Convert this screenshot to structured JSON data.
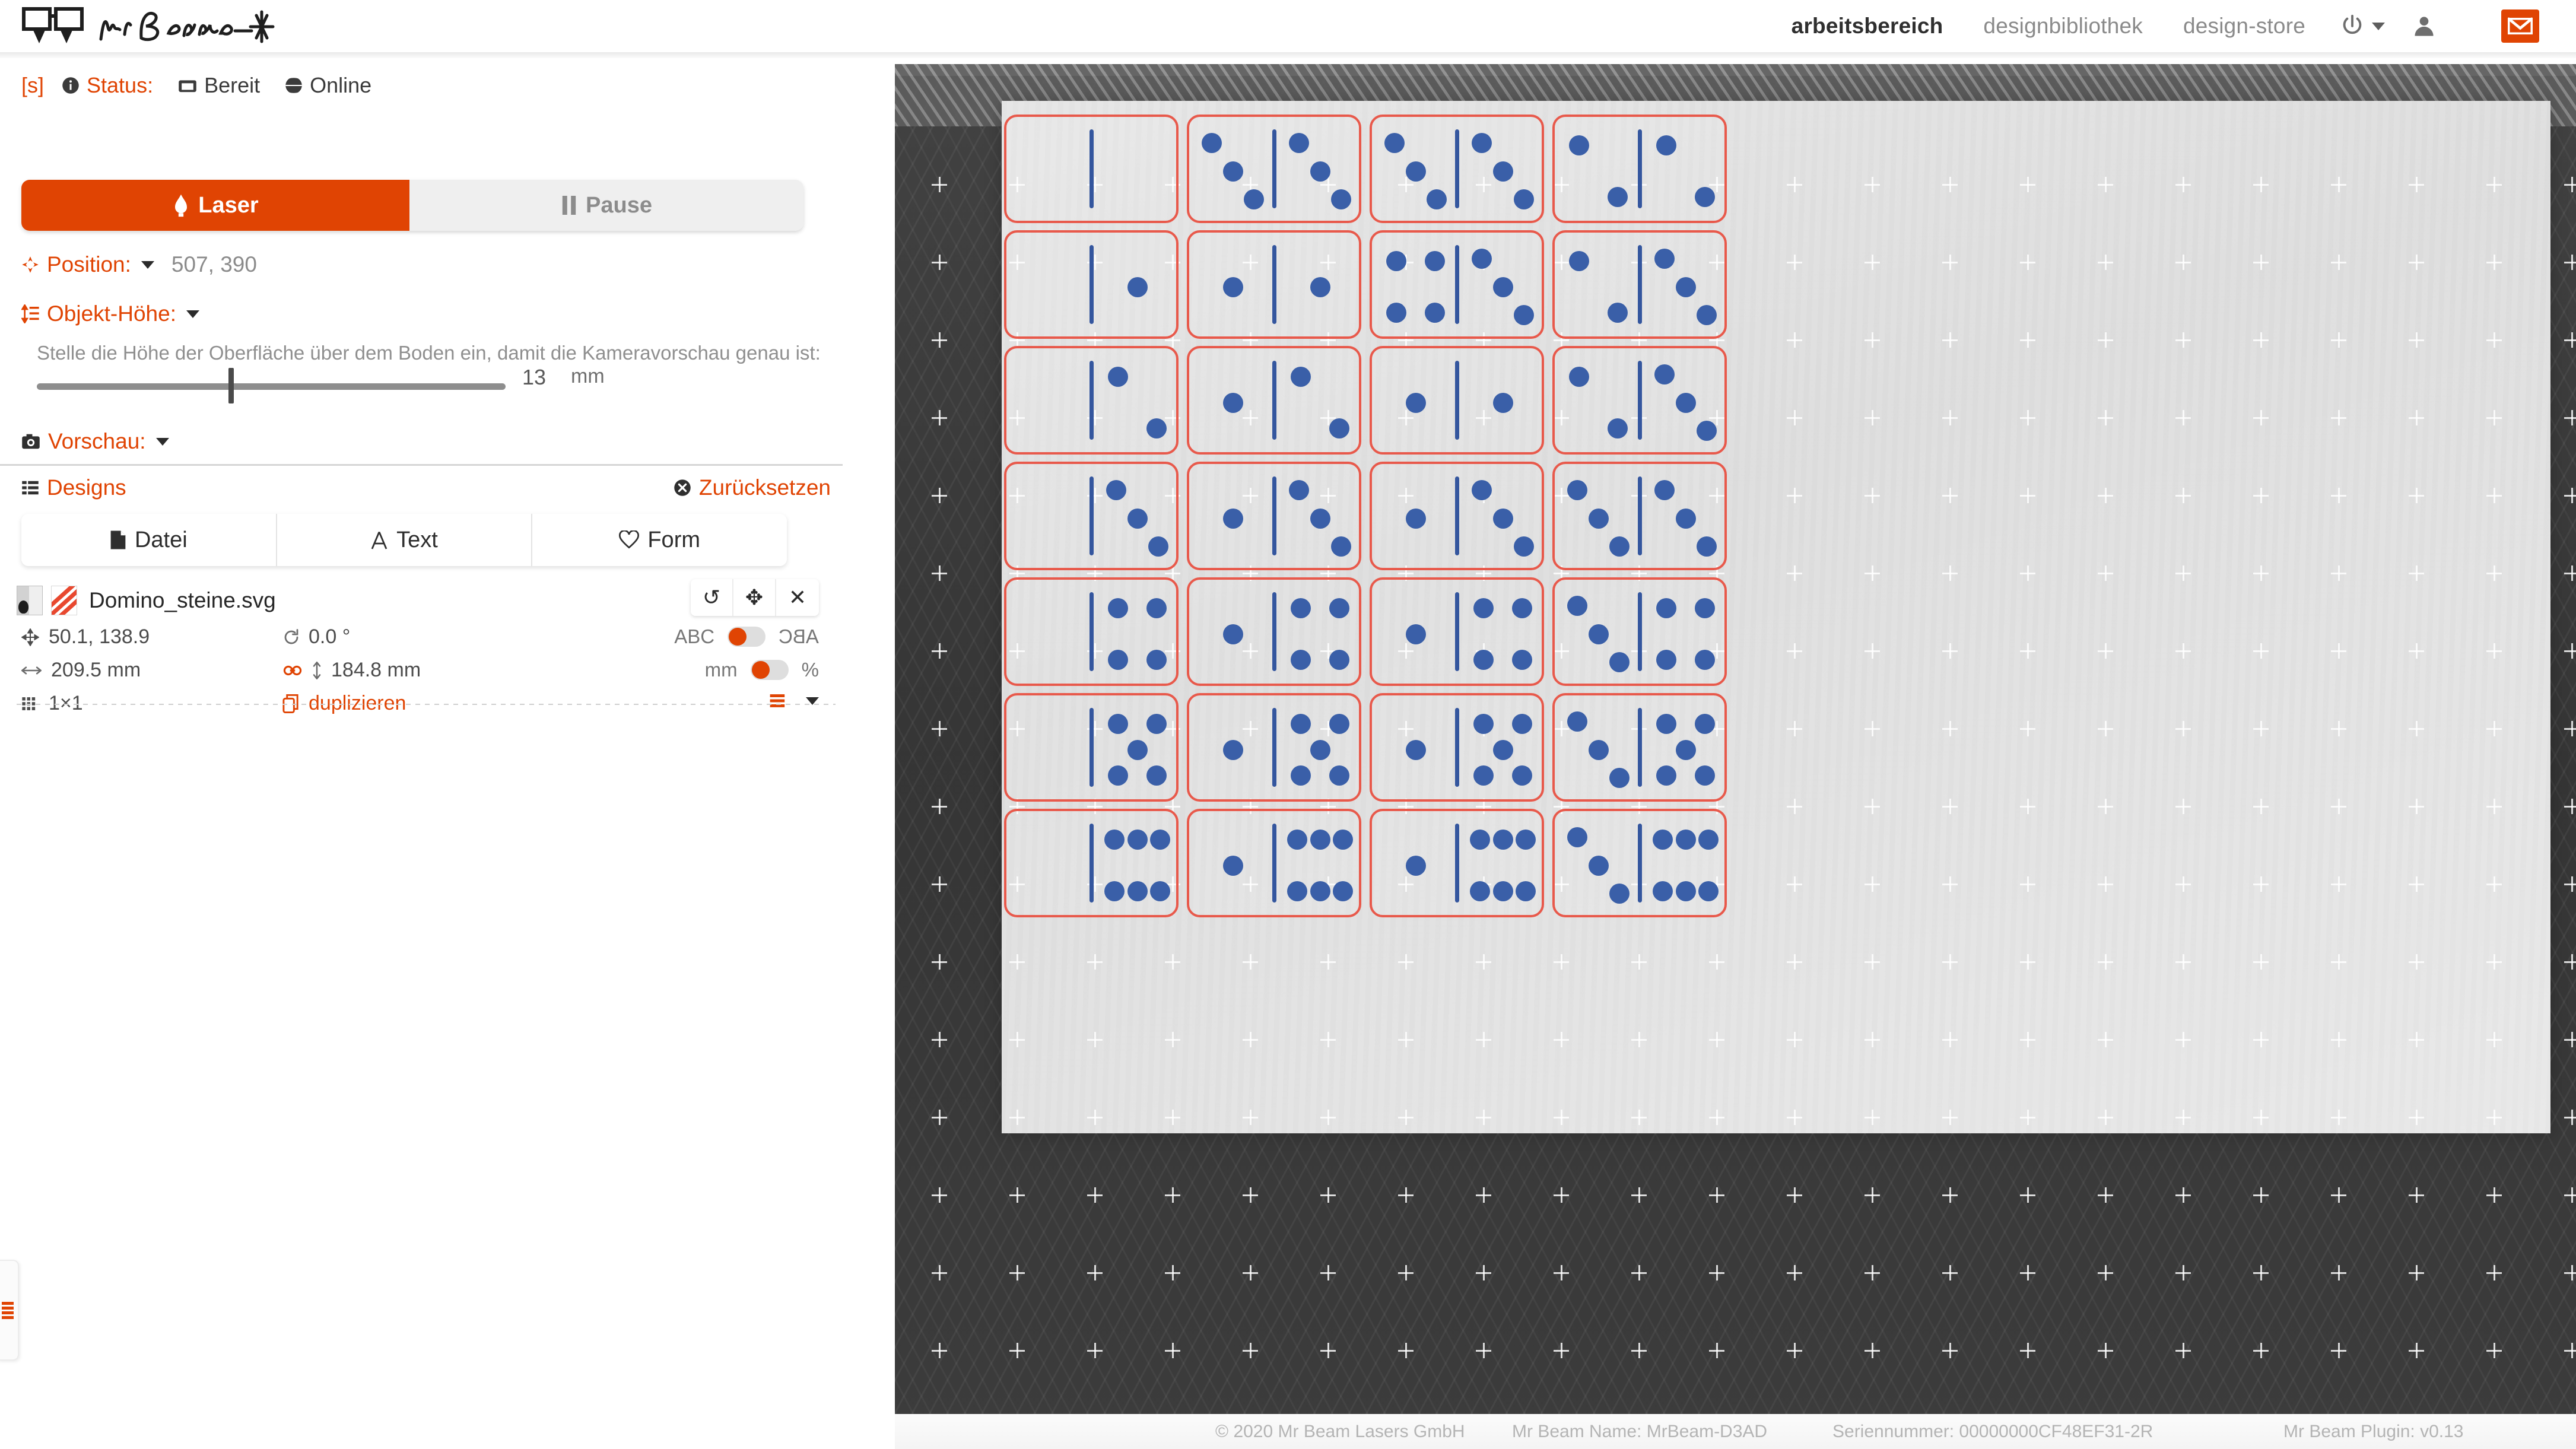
{
  "nav": {
    "brand": "Mr Beam",
    "links": [
      {
        "label": "arbeitsbereich",
        "active": true
      },
      {
        "label": "designbibliothek",
        "active": false
      },
      {
        "label": "design-store",
        "active": false
      }
    ],
    "power_icon": "power-icon",
    "user_icon": "user-icon",
    "mail_icon": "mail-icon",
    "accent": "#e04403"
  },
  "status": {
    "shortcut": "[s]",
    "label": "Status:",
    "state": "Bereit",
    "connection": "Online",
    "info_icon": "info-icon",
    "lid_icon": "lid-icon",
    "globe_icon": "globe-icon"
  },
  "controls": {
    "laser_label": "Laser",
    "laser_icon": "flame-icon",
    "pause_label": "Pause",
    "pause_icon": "pause-icon"
  },
  "position": {
    "label": "Position:",
    "value": "507, 390",
    "icon": "crosshair-icon"
  },
  "object_height": {
    "label": "Objekt-Höhe:",
    "icon": "height-icon",
    "help": "Stelle die Höhe der Oberfläche über dem Boden ein, damit die Kameravorschau genau ist:",
    "value": "13",
    "unit": "mm",
    "slider_percent": 41
  },
  "preview": {
    "label": "Vorschau:",
    "icon": "camera-icon"
  },
  "designs": {
    "label": "Designs",
    "icon": "list-icon",
    "reset_label": "Zurücksetzen",
    "reset_icon": "close-circle-icon",
    "tabs": [
      {
        "label": "Datei",
        "icon": "file-icon"
      },
      {
        "label": "Text",
        "icon": "text-icon"
      },
      {
        "label": "Form",
        "icon": "heart-icon"
      }
    ]
  },
  "file": {
    "name": "Domino_steine.svg",
    "actions": [
      {
        "name": "rotate",
        "glyph": "↺"
      },
      {
        "name": "move",
        "glyph": "✥"
      },
      {
        "name": "remove",
        "glyph": "✕"
      }
    ],
    "position": "50.1, 138.9",
    "position_icon": "move-icon",
    "rotation": "0.0 °",
    "rotation_icon": "rotate-icon",
    "width": "209.5 mm",
    "width_icon": "width-icon",
    "height": "184.8 mm",
    "height_icon": "height-arrow-icon",
    "link_icon": "link-icon",
    "grid": "1×1",
    "grid_icon": "grid-icon",
    "duplicate_label": "duplizieren",
    "duplicate_icon": "copy-icon",
    "toggle_text_left": "ABC",
    "toggle_text_right": "ABC",
    "toggle_unit_left": "mm",
    "toggle_unit_right": "%",
    "menu_icon": "hamburger-icon"
  },
  "workarea": {
    "material_label": "material-sheet",
    "tile_outline_color": "#e8594b",
    "pip_color": "#3a5fa8"
  },
  "dominoes": {
    "rows": 7,
    "cols": 4,
    "tiles": [
      [
        0,
        0
      ],
      [
        3,
        3
      ],
      [
        3,
        3
      ],
      [
        2,
        2
      ],
      [
        0,
        1
      ],
      [
        1,
        1
      ],
      [
        4,
        3
      ],
      [
        2,
        3
      ],
      [
        0,
        2
      ],
      [
        1,
        2
      ],
      [
        1,
        1
      ],
      [
        2,
        3
      ],
      [
        0,
        3
      ],
      [
        1,
        3
      ],
      [
        1,
        3
      ],
      [
        3,
        3
      ],
      [
        0,
        4
      ],
      [
        1,
        4
      ],
      [
        1,
        4
      ],
      [
        3,
        4
      ],
      [
        0,
        5
      ],
      [
        1,
        5
      ],
      [
        1,
        5
      ],
      [
        3,
        5
      ],
      [
        0,
        6
      ],
      [
        1,
        6
      ],
      [
        1,
        6
      ],
      [
        3,
        6
      ]
    ]
  },
  "footer": {
    "copyright": "© 2020 Mr Beam Lasers GmbH",
    "device_name": "Mr Beam Name: MrBeam-D3AD",
    "serial": "Seriennummer: 00000000CF48EF31-2R",
    "plugin": "Mr Beam Plugin: v0.13"
  }
}
